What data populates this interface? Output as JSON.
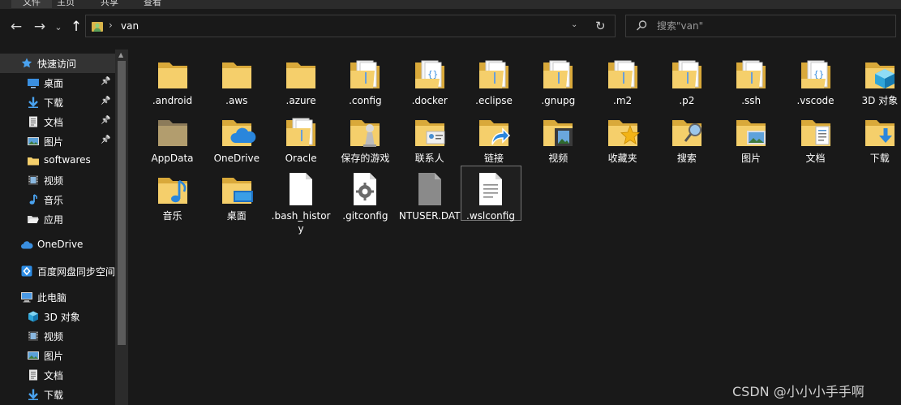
{
  "ribbon": {
    "tabs": [
      {
        "label": "文件",
        "active": true
      },
      {
        "label": "主页",
        "active": false
      },
      {
        "label": "共享",
        "active": false
      },
      {
        "label": "查看",
        "active": false
      }
    ]
  },
  "address": {
    "segments": [
      "van"
    ]
  },
  "search": {
    "placeholder": "搜索\"van\""
  },
  "sidebar": {
    "items": [
      {
        "label": "快速访问",
        "icon": "star-icon",
        "indent": 0,
        "selected": true,
        "pinned": false
      },
      {
        "label": "桌面",
        "icon": "desktop-icon",
        "indent": 1,
        "pinned": true
      },
      {
        "label": "下载",
        "icon": "download-icon",
        "indent": 1,
        "pinned": true
      },
      {
        "label": "文档",
        "icon": "document-icon",
        "indent": 1,
        "pinned": true
      },
      {
        "label": "图片",
        "icon": "picture-icon",
        "indent": 1,
        "pinned": true
      },
      {
        "label": "softwares",
        "icon": "folder-icon",
        "indent": 1,
        "pinned": false
      },
      {
        "label": "视频",
        "icon": "video-icon",
        "indent": 1,
        "pinned": false
      },
      {
        "label": "音乐",
        "icon": "music-icon",
        "indent": 1,
        "pinned": false
      },
      {
        "label": "应用",
        "icon": "open-folder-icon",
        "indent": 1,
        "pinned": false
      },
      {
        "label": "OneDrive",
        "icon": "cloud-icon",
        "indent": 0,
        "pinned": false
      },
      {
        "label": "百度网盘同步空间",
        "icon": "baidu-netdisk-icon",
        "indent": 0,
        "pinned": false
      },
      {
        "label": "此电脑",
        "icon": "computer-icon",
        "indent": 0,
        "pinned": false
      },
      {
        "label": "3D 对象",
        "icon": "cube-icon",
        "indent": 1,
        "pinned": false
      },
      {
        "label": "视频",
        "icon": "video-icon",
        "indent": 1,
        "pinned": false
      },
      {
        "label": "图片",
        "icon": "picture-icon",
        "indent": 1,
        "pinned": false
      },
      {
        "label": "文档",
        "icon": "document-icon",
        "indent": 1,
        "pinned": false
      },
      {
        "label": "下载",
        "icon": "download-icon",
        "indent": 1,
        "pinned": false
      }
    ]
  },
  "files": [
    {
      "name": ".android",
      "icon": "folder-icon"
    },
    {
      "name": ".aws",
      "icon": "folder-icon"
    },
    {
      "name": ".azure",
      "icon": "folder-icon"
    },
    {
      "name": ".config",
      "icon": "folder-papers-icon"
    },
    {
      "name": ".docker",
      "icon": "folder-code-icon"
    },
    {
      "name": ".eclipse",
      "icon": "folder-papers-icon"
    },
    {
      "name": ".gnupg",
      "icon": "folder-papers-icon"
    },
    {
      "name": ".m2",
      "icon": "folder-papers-icon"
    },
    {
      "name": ".p2",
      "icon": "folder-papers-icon"
    },
    {
      "name": ".ssh",
      "icon": "folder-papers-icon"
    },
    {
      "name": ".vscode",
      "icon": "folder-code-icon"
    },
    {
      "name": "3D 对象",
      "icon": "folder-3d-icon"
    },
    {
      "name": "AppData",
      "icon": "folder-hidden-icon"
    },
    {
      "name": "OneDrive",
      "icon": "folder-onedrive-icon"
    },
    {
      "name": "Oracle",
      "icon": "folder-papers-icon"
    },
    {
      "name": "保存的游戏",
      "icon": "folder-games-icon"
    },
    {
      "name": "联系人",
      "icon": "folder-contacts-icon"
    },
    {
      "name": "链接",
      "icon": "folder-links-icon"
    },
    {
      "name": "视频",
      "icon": "folder-video-icon"
    },
    {
      "name": "收藏夹",
      "icon": "folder-favorites-icon"
    },
    {
      "name": "搜索",
      "icon": "folder-search-icon"
    },
    {
      "name": "图片",
      "icon": "folder-pictures-icon"
    },
    {
      "name": "文档",
      "icon": "folder-documents-icon"
    },
    {
      "name": "下载",
      "icon": "folder-downloads-icon"
    },
    {
      "name": "音乐",
      "icon": "folder-music-icon"
    },
    {
      "name": "桌面",
      "icon": "folder-desktop-icon"
    },
    {
      "name": ".bash_history",
      "icon": "file-blank-icon"
    },
    {
      "name": ".gitconfig",
      "icon": "file-config-icon"
    },
    {
      "name": "NTUSER.DAT",
      "icon": "file-system-icon"
    },
    {
      "name": ".wslconfig",
      "icon": "file-text-icon",
      "selected": true
    }
  ],
  "watermark": "CSDN @小小小手手啊",
  "colors": {
    "background": "#191919",
    "folder": "#f5cf6b",
    "accent": "#3a9ee6",
    "selected_border": "#777777"
  }
}
